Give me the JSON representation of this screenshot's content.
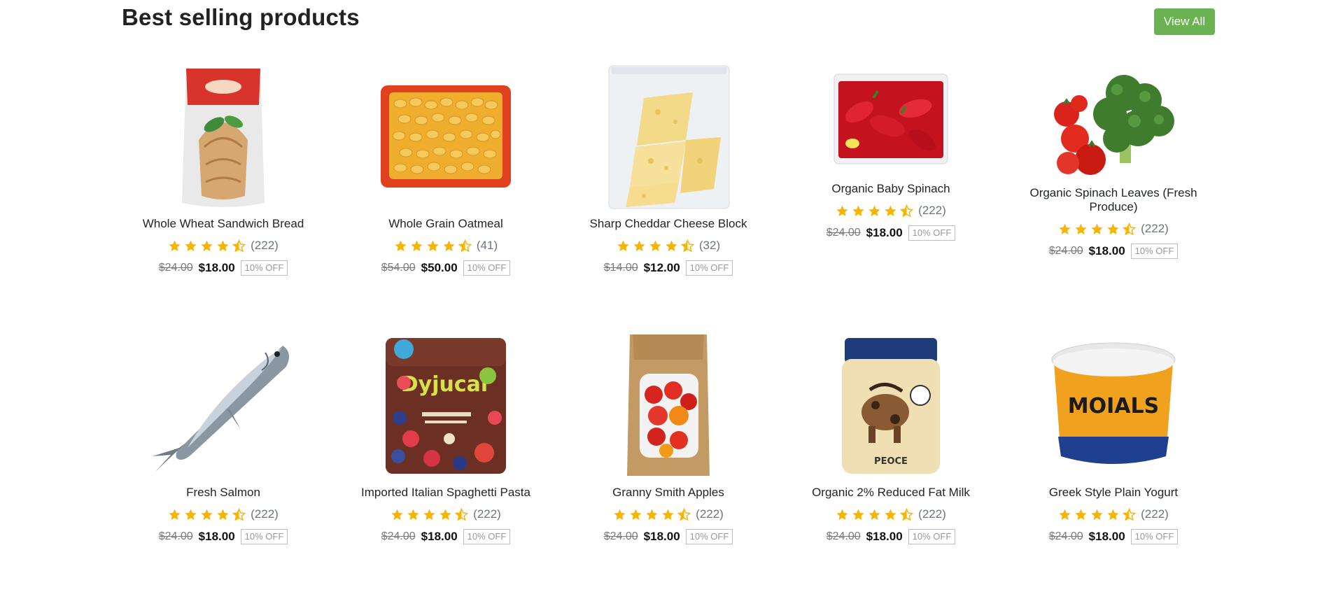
{
  "section": {
    "title": "Best selling products",
    "view_all_label": "View All"
  },
  "colors": {
    "accent": "#6bb252",
    "star": "#f7b500"
  },
  "products": [
    {
      "name": "Whole Wheat Sandwich Bread",
      "rating": 4.5,
      "reviews": "(222)",
      "old_price": "$24.00",
      "price": "$18.00",
      "badge": "10% OFF",
      "image": "bread-package-image"
    },
    {
      "name": "Whole Grain Oatmeal",
      "rating": 4.5,
      "reviews": "(41)",
      "old_price": "$54.00",
      "price": "$50.00",
      "badge": "10% OFF",
      "image": "oatmeal-tray-image"
    },
    {
      "name": "Sharp Cheddar Cheese Block",
      "rating": 4.5,
      "reviews": "(32)",
      "old_price": "$14.00",
      "price": "$12.00",
      "badge": "10% OFF",
      "image": "cheese-bag-image"
    },
    {
      "name": "Organic Baby Spinach",
      "rating": 4.5,
      "reviews": "(222)",
      "old_price": "$24.00",
      "price": "$18.00",
      "badge": "10% OFF",
      "image": "red-peppers-bag-image"
    },
    {
      "name": "Organic Spinach Leaves (Fresh Produce)",
      "rating": 4.5,
      "reviews": "(222)",
      "old_price": "$24.00",
      "price": "$18.00",
      "badge": "10% OFF",
      "image": "broccoli-tomatoes-image"
    },
    {
      "name": "Fresh Salmon",
      "rating": 4.5,
      "reviews": "(222)",
      "old_price": "$24.00",
      "price": "$18.00",
      "badge": "10% OFF",
      "image": "fish-image"
    },
    {
      "name": "Imported Italian Spaghetti Pasta",
      "rating": 4.5,
      "reviews": "(222)",
      "old_price": "$24.00",
      "price": "$18.00",
      "badge": "10% OFF",
      "image": "fruit-package-image",
      "image_label": "Dyjucal"
    },
    {
      "name": "Granny Smith Apples",
      "rating": 4.5,
      "reviews": "(222)",
      "old_price": "$24.00",
      "price": "$18.00",
      "badge": "10% OFF",
      "image": "apple-bag-image"
    },
    {
      "name": "Organic 2% Reduced Fat Milk",
      "rating": 4.5,
      "reviews": "(222)",
      "old_price": "$24.00",
      "price": "$18.00",
      "badge": "10% OFF",
      "image": "cow-jar-image",
      "image_label": "PEOCE"
    },
    {
      "name": "Greek Style Plain Yogurt",
      "rating": 4.5,
      "reviews": "(222)",
      "old_price": "$24.00",
      "price": "$18.00",
      "badge": "10% OFF",
      "image": "yogurt-tub-image",
      "image_label": "MOIALS"
    }
  ]
}
